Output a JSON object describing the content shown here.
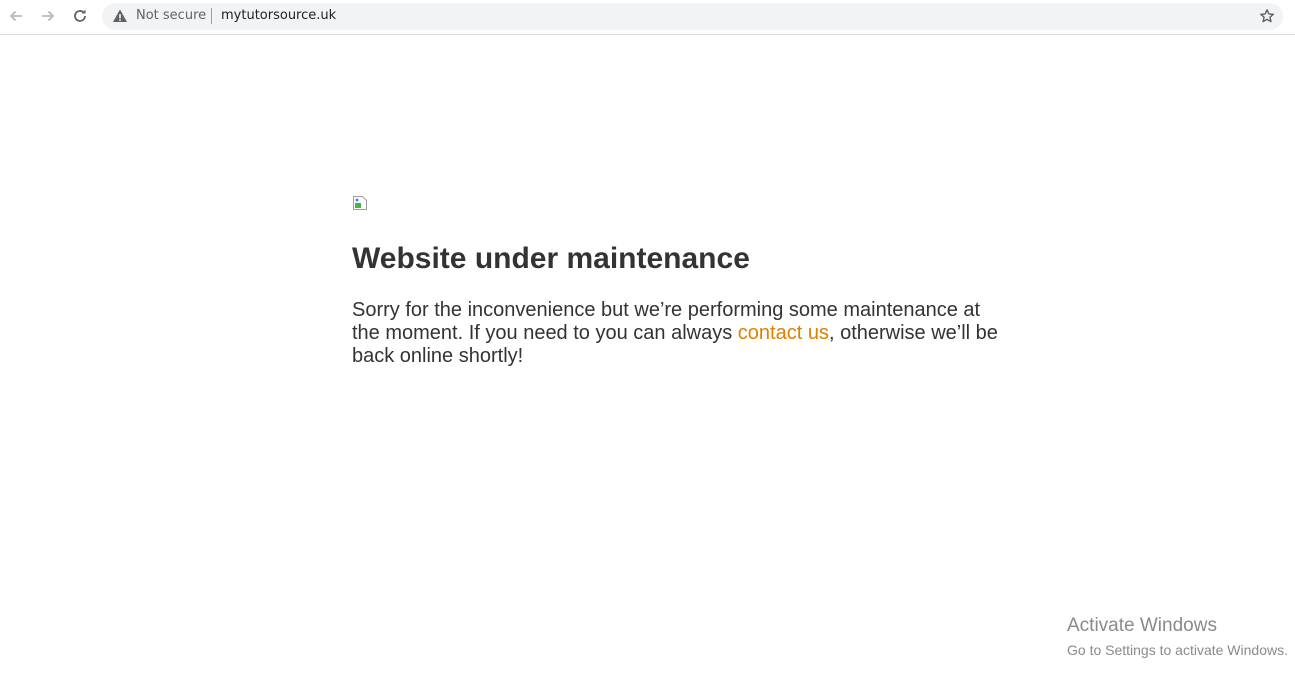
{
  "browser": {
    "security_label": "Not secure",
    "url": "mytutorsource.uk",
    "icons": {
      "back": "back-arrow-icon",
      "forward": "forward-arrow-icon",
      "reload": "reload-icon",
      "warning": "warning-icon",
      "bookmark": "star-icon"
    }
  },
  "page": {
    "heading": "Website under maintenance",
    "message_part1": "Sorry for the inconvenience but we’re performing some maintenance at the moment. If you need to you can always ",
    "link_text": "contact us",
    "message_part2": ", otherwise we’ll be back online shortly!",
    "link_color": "#dc8100",
    "text_color": "#333333"
  },
  "watermark": {
    "title": "Activate Windows",
    "subtitle": "Go to Settings to activate Windows."
  }
}
